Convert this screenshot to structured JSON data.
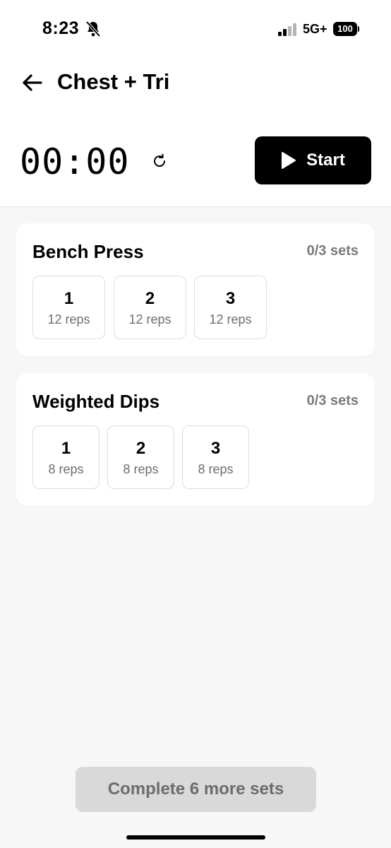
{
  "status_bar": {
    "time": "8:23",
    "network": "5G+",
    "battery": "100",
    "icons": [
      "bell-slash-icon",
      "signal-icon",
      "battery-icon"
    ]
  },
  "header": {
    "title": "Chest + Tri",
    "back_icon": "arrow-left-icon"
  },
  "timer": {
    "display": "00:00",
    "reset_icon": "refresh-icon",
    "start_label": "Start",
    "start_icon": "play-icon"
  },
  "exercises": [
    {
      "name": "Bench Press",
      "progress": "0/3 sets",
      "sets": [
        {
          "number": "1",
          "reps": "12 reps"
        },
        {
          "number": "2",
          "reps": "12 reps"
        },
        {
          "number": "3",
          "reps": "12 reps"
        }
      ]
    },
    {
      "name": "Weighted Dips",
      "progress": "0/3 sets",
      "sets": [
        {
          "number": "1",
          "reps": "8 reps"
        },
        {
          "number": "2",
          "reps": "8 reps"
        },
        {
          "number": "3",
          "reps": "8 reps"
        }
      ]
    }
  ],
  "footer": {
    "complete_label": "Complete 6 more sets"
  },
  "colors": {
    "accent": "#000000",
    "background": "#f7f7f7",
    "card": "#ffffff",
    "muted_text": "#7a7a7a",
    "disabled_button": "#d9d9d9"
  }
}
